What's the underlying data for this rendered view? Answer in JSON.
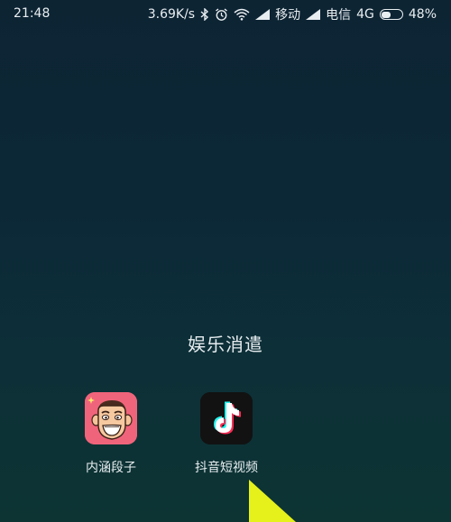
{
  "status_bar": {
    "time": "21:48",
    "speed": "3.69K/s",
    "carrier1": "移动",
    "carrier2": "电信",
    "network": "4G",
    "battery_percent": "48%",
    "battery_level": 0.48,
    "icons": [
      "bluetooth-icon",
      "alarm-icon",
      "wifi-icon",
      "signal-icon"
    ]
  },
  "folder": {
    "title": "娱乐消遣",
    "apps": [
      {
        "label": "内涵段子",
        "icon": "neihan-duanzi-icon",
        "color": "#f0647b"
      },
      {
        "label": "抖音短视频",
        "icon": "douyin-icon",
        "color": "#121212"
      }
    ]
  },
  "colors": {
    "background_top": "#0d2433",
    "background_bottom": "#0d3433",
    "cursor": "#e6f01a"
  }
}
